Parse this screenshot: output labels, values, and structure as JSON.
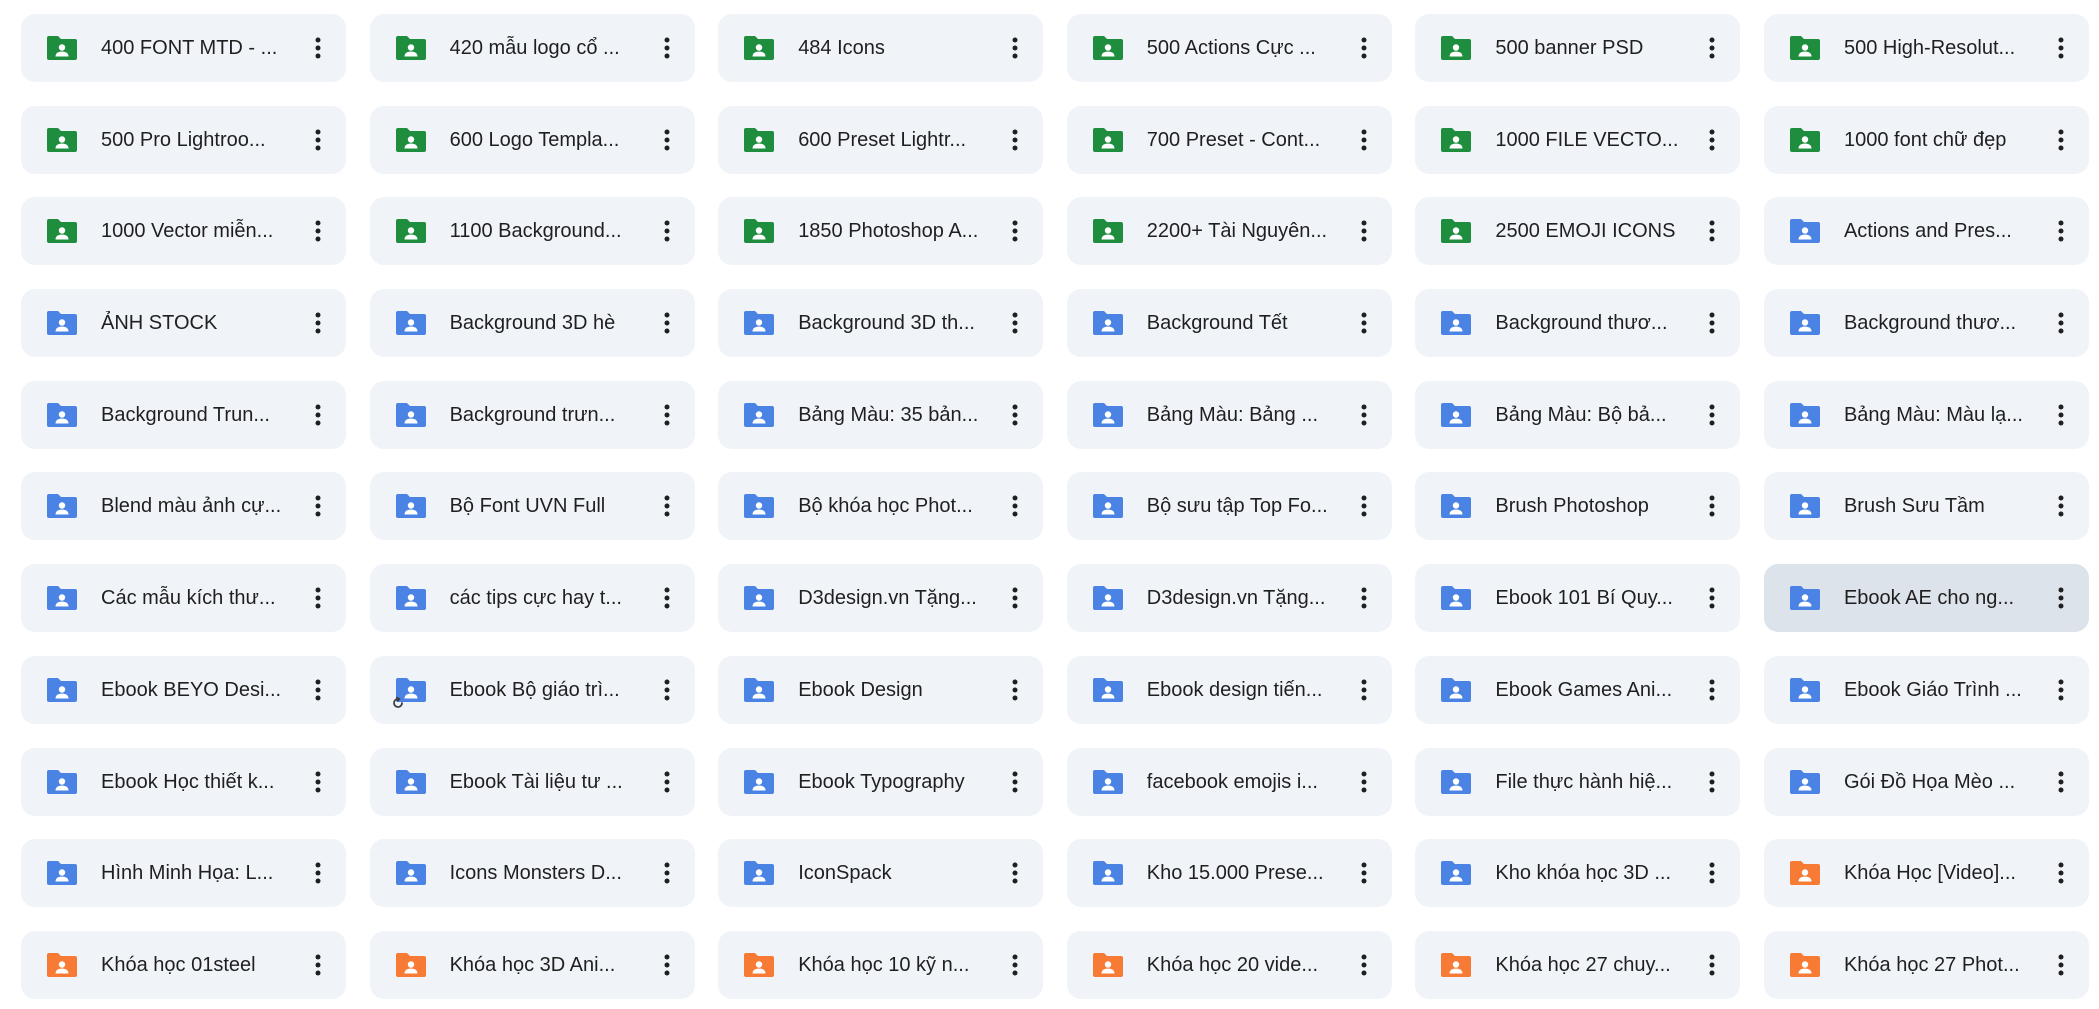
{
  "colors": {
    "green": "#1e8e3e",
    "blue": "#4a83e4",
    "orange": "#f77b35",
    "tile_bg": "#f0f4f9",
    "tile_selected_bg": "#dde3ea"
  },
  "icons": {
    "folder": "shared-folder-icon",
    "more": "more-vert-icon",
    "loading": "loading-spinner-icon"
  },
  "folders": [
    {
      "name": "400 FONT MTD - ...",
      "color": "green"
    },
    {
      "name": "420 mẫu logo cổ ...",
      "color": "green"
    },
    {
      "name": "484 Icons",
      "color": "green"
    },
    {
      "name": "500 Actions Cực ...",
      "color": "green"
    },
    {
      "name": "500 banner PSD",
      "color": "green"
    },
    {
      "name": "500 High-Resolut...",
      "color": "green"
    },
    {
      "name": "500 Pro Lightroo...",
      "color": "green"
    },
    {
      "name": "600 Logo Templa...",
      "color": "green"
    },
    {
      "name": "600 Preset Lightr...",
      "color": "green"
    },
    {
      "name": "700 Preset - Cont...",
      "color": "green"
    },
    {
      "name": "1000 FILE VECTO...",
      "color": "green"
    },
    {
      "name": "1000 font chữ đẹp",
      "color": "green"
    },
    {
      "name": "1000 Vector miễn...",
      "color": "green"
    },
    {
      "name": "1100 Background...",
      "color": "green"
    },
    {
      "name": "1850 Photoshop A...",
      "color": "green"
    },
    {
      "name": "2200+ Tài Nguyên...",
      "color": "green"
    },
    {
      "name": "2500 EMOJI ICONS",
      "color": "green"
    },
    {
      "name": "Actions and Pres...",
      "color": "blue"
    },
    {
      "name": "ẢNH STOCK",
      "color": "blue"
    },
    {
      "name": "Background 3D hè",
      "color": "blue"
    },
    {
      "name": "Background 3D th...",
      "color": "blue"
    },
    {
      "name": "Background Tết",
      "color": "blue"
    },
    {
      "name": "Background thươ...",
      "color": "blue"
    },
    {
      "name": "Background thươ...",
      "color": "blue"
    },
    {
      "name": "Background Trun...",
      "color": "blue"
    },
    {
      "name": "Background trưn...",
      "color": "blue"
    },
    {
      "name": "Bảng Màu: 35 bản...",
      "color": "blue"
    },
    {
      "name": "Bảng Màu: Bảng ...",
      "color": "blue"
    },
    {
      "name": "Bảng Màu: Bộ bả...",
      "color": "blue"
    },
    {
      "name": "Bảng Màu: Màu lạ...",
      "color": "blue"
    },
    {
      "name": "Blend màu ảnh cự...",
      "color": "blue"
    },
    {
      "name": "Bộ Font UVN Full",
      "color": "blue"
    },
    {
      "name": "Bộ khóa học Phot...",
      "color": "blue"
    },
    {
      "name": "Bộ sưu tập Top Fo...",
      "color": "blue"
    },
    {
      "name": "Brush Photoshop",
      "color": "blue"
    },
    {
      "name": "Brush Sưu Tầm",
      "color": "blue"
    },
    {
      "name": "Các mẫu kích thư...",
      "color": "blue"
    },
    {
      "name": "các tips cực hay t...",
      "color": "blue"
    },
    {
      "name": "D3design.vn Tặng...",
      "color": "blue"
    },
    {
      "name": "D3design.vn Tặng...",
      "color": "blue"
    },
    {
      "name": "Ebook 101 Bí Quy...",
      "color": "blue"
    },
    {
      "name": "Ebook AE cho ng...",
      "color": "blue",
      "selected": true
    },
    {
      "name": "Ebook BEYO Desi...",
      "color": "blue"
    },
    {
      "name": "Ebook Bộ giáo trì...",
      "color": "blue",
      "loading": true
    },
    {
      "name": "Ebook Design",
      "color": "blue"
    },
    {
      "name": "Ebook design tiến...",
      "color": "blue"
    },
    {
      "name": "Ebook Games Ani...",
      "color": "blue"
    },
    {
      "name": "Ebook Giáo Trình ...",
      "color": "blue"
    },
    {
      "name": "Ebook Học thiết k...",
      "color": "blue"
    },
    {
      "name": "Ebook Tài liệu tư ...",
      "color": "blue"
    },
    {
      "name": "Ebook Typography",
      "color": "blue"
    },
    {
      "name": "facebook emojis i...",
      "color": "blue"
    },
    {
      "name": "File thực hành hiệ...",
      "color": "blue"
    },
    {
      "name": "Gói Đồ Họa Mèo ...",
      "color": "blue"
    },
    {
      "name": "Hình Minh Họa: L...",
      "color": "blue"
    },
    {
      "name": "Icons Monsters D...",
      "color": "blue"
    },
    {
      "name": "IconSpack",
      "color": "blue"
    },
    {
      "name": "Kho 15.000 Prese...",
      "color": "blue"
    },
    {
      "name": "Kho khóa học 3D ...",
      "color": "blue"
    },
    {
      "name": "Khóa Học [Video]...",
      "color": "orange"
    },
    {
      "name": "Khóa học 01steel",
      "color": "orange"
    },
    {
      "name": "Khóa học 3D Ani...",
      "color": "orange"
    },
    {
      "name": "Khóa học 10 kỹ n...",
      "color": "orange"
    },
    {
      "name": "Khóa học 20 vide...",
      "color": "orange"
    },
    {
      "name": "Khóa học 27 chuy...",
      "color": "orange"
    },
    {
      "name": "Khóa học 27 Phot...",
      "color": "orange"
    }
  ]
}
